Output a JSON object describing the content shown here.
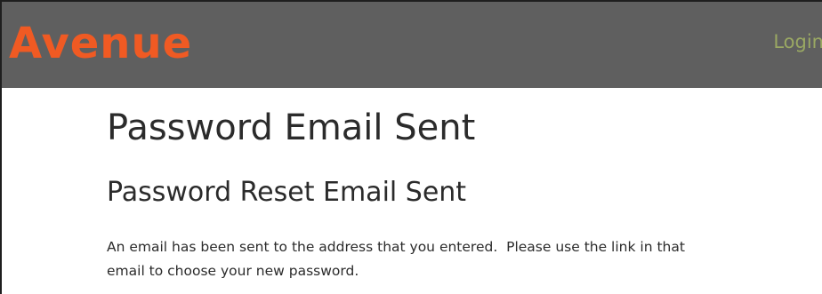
{
  "navbar": {
    "brand": "Avenue",
    "login_label": "Login"
  },
  "main": {
    "page_title": "Password Email Sent",
    "heading": "Password Reset Email Sent",
    "message_line1": "An email has been sent to the address that you entered.  Please use the link in that",
    "message_line2": "email to choose your new password."
  },
  "colors": {
    "navbar_bg": "#5f5f5f",
    "brand_orange": "#f05a23",
    "login_link": "#9aa863",
    "text": "#2b2b2b"
  }
}
